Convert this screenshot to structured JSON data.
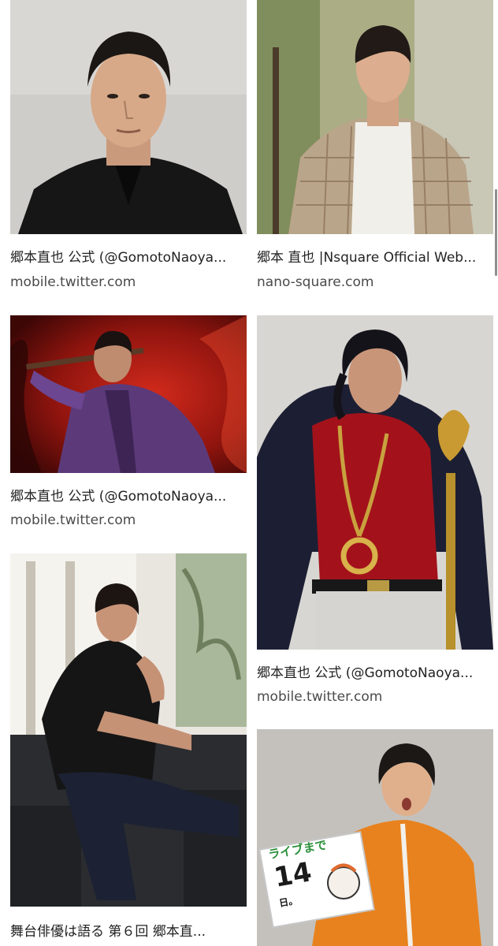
{
  "results": [
    {
      "title": "郷本直也 公式 (@GomotoNaoya...",
      "domain": "mobile.twitter.com",
      "image": "portrait-black-shirt"
    },
    {
      "title": "郷本 直也 |Nsquare Official Web...",
      "domain": "nano-square.com",
      "image": "portrait-plaid-jacket"
    },
    {
      "title": "郷本直也 公式 (@GomotoNaoya...",
      "domain": "mobile.twitter.com",
      "image": "stage-purple-kimono-red-background"
    },
    {
      "title": "郷本直也 公式 (@GomotoNaoya...",
      "domain": "mobile.twitter.com",
      "image": "portrait-red-shirt-fur-coat"
    },
    {
      "title": "舞台俳優は語る 第６回 郷本直...",
      "domain": "",
      "image": "portrait-seated-chair"
    },
    {
      "title": "",
      "domain": "",
      "image": "portrait-orange-jacket-sign",
      "sign_text": "ライブまで",
      "sign_number": "14",
      "sign_small": "日。"
    }
  ]
}
